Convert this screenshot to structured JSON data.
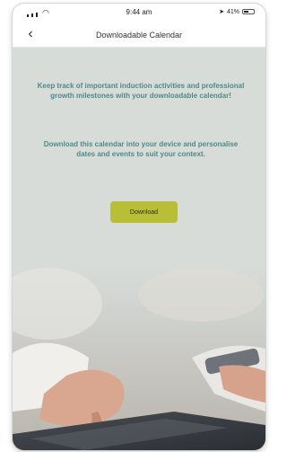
{
  "status_bar": {
    "time": "9:44 am",
    "battery_percent": "41%"
  },
  "nav": {
    "back_icon": "chevron-left-icon",
    "title": "Downloadable Calendar"
  },
  "content": {
    "intro_text": "Keep track of important induction activities and professional growth milestones with your downloadable calendar!",
    "details_text": "Download this calendar into your device and personalise dates and events to suit your context.",
    "download_label": "Download"
  },
  "colors": {
    "text_accent": "#4f8a87",
    "button": "#b8bf36",
    "background": "#d7dcd9"
  }
}
